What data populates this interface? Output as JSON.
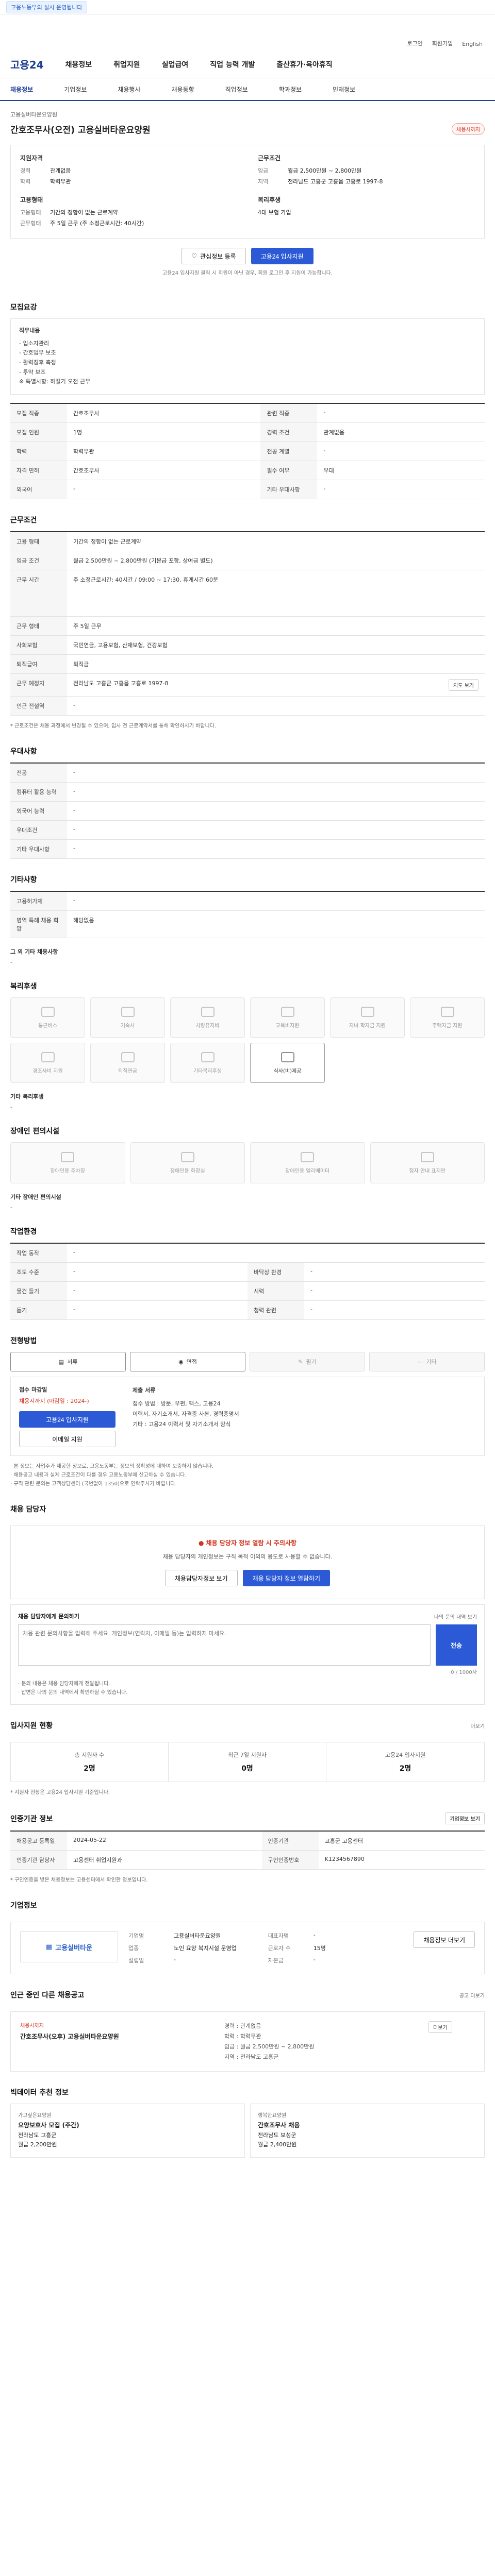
{
  "topbar": {
    "banner": "고용노동부의 실시 운영됩니다"
  },
  "util": {
    "login": "로그인",
    "join": "회원가입",
    "lang": "English"
  },
  "gnb": {
    "logo": "고용24",
    "menus": [
      "채용정보",
      "취업지원",
      "실업급여",
      "직업 능력 개발",
      "출산휴가·육아휴직"
    ]
  },
  "lnb": {
    "items": [
      "채용정보",
      "기업정보",
      "채용행사",
      "채용동향",
      "직업정보",
      "학과정보",
      "인재정보"
    ]
  },
  "job": {
    "company": "고용실버타운요양원",
    "title": "간호조무사(오전) 고용실버타운요양원",
    "badge": "채용시까지"
  },
  "summary": {
    "qual_title": "지원자격",
    "qual": [
      {
        "k": "경력",
        "v": "관계없음"
      },
      {
        "k": "학력",
        "v": "학력무관"
      }
    ],
    "cond_title": "근무조건",
    "cond": [
      {
        "k": "임금",
        "v": "월급 2,500만원 ~ 2,800만원"
      },
      {
        "k": "지역",
        "v": "전라남도 고흥군 고흥읍 고흥로 1997-8"
      }
    ],
    "place_title": "고용형태",
    "place": [
      {
        "k": "고용형태",
        "v": "기간의 정함이 없는 근로계약"
      },
      {
        "k": "근무형태",
        "v": "주 5일 근무 (주 소정근로시간: 40시간)"
      }
    ],
    "welfare_title": "복리후생",
    "welfare": "4대 보험 가입"
  },
  "actions": {
    "scrap": "관심정보 등록",
    "apply": "고용24 입사지원"
  },
  "note_center": "고용24 입사지원 클릭 시 회원이 아닌 경우, 회원 로그인 후 지원이 가능합니다.",
  "s_recruit": {
    "title": "모집요강",
    "intro_title": "직무내용",
    "intro_lines": [
      "- 입소자관리",
      "- 간호업무 보조",
      "- 활력징후 측정",
      "- 투약 보조",
      "※ 특별사항: 하절기 오전 근무"
    ],
    "rows": [
      {
        "k1": "모집 직종",
        "v1": "간호조무사",
        "k2": "관련 직종",
        "v2": "-"
      },
      {
        "k1": "모집 인원",
        "v1": "1명",
        "k2": "경력 조건",
        "v2": "관계없음"
      },
      {
        "k1": "학력",
        "v1": "학력무관",
        "k2": "전공 계열",
        "v2": "-"
      },
      {
        "k1": "자격 면허",
        "v1": "간호조무사",
        "k2": "필수 여부",
        "v2": "우대"
      },
      {
        "k1": "외국어",
        "v1": "-",
        "k2": "기타 우대사항",
        "v2": "-"
      }
    ]
  },
  "s_cond": {
    "title": "근무조건",
    "rows": [
      {
        "k": "고용 형태",
        "v": "기간의 정함이 없는 근로계약"
      },
      {
        "k": "임금 조건",
        "v": "월급 2,500만원 ~ 2,800만원 (기본급 포함, 상여금 별도)"
      },
      {
        "k": "근무 시간",
        "v": "주 소정근로시간: 40시간  /  09:00 ~ 17:30, 휴게시간 60분"
      },
      {
        "k": "근무 형태",
        "v": "주 5일 근무"
      },
      {
        "k": "사회보험",
        "v": "국민연금, 고용보험, 산재보험, 건강보험"
      },
      {
        "k": "퇴직급여",
        "v": "퇴직금"
      },
      {
        "k": "근무 예정지",
        "v": "전라남도 고흥군 고흥읍 고흥로 1997-8"
      },
      {
        "k": "인근 전철역",
        "v": "-"
      }
    ],
    "map_btn": "지도 보기",
    "foot": "* 근로조건은 채용 과정에서 변경될 수 있으며, 입사 전 근로계약서를 통해 확인하시기 바랍니다."
  },
  "s_prefer": {
    "title": "우대사항",
    "rows": [
      {
        "k": "전공",
        "v": "-"
      },
      {
        "k": "컴퓨터 활용 능력",
        "v": "-"
      },
      {
        "k": "외국어 능력",
        "v": "-"
      },
      {
        "k": "우대조건",
        "v": "-"
      },
      {
        "k": "기타 우대사항",
        "v": "-"
      }
    ]
  },
  "s_etc": {
    "title": "기타사항",
    "rows": [
      {
        "k": "고용허가제",
        "v": "-"
      },
      {
        "k": "병역 특례 채용 희망",
        "v": "해당없음"
      }
    ],
    "extra_title": "그 외 기타 채용사항",
    "extra_val": "-"
  },
  "s_welfare": {
    "title": "복리후생",
    "cards": [
      "통근버스",
      "기숙사",
      "차량유지비",
      "교육비지원",
      "자녀 학자금 지원",
      "주택자금 지원",
      "경조사비 지원",
      "퇴직연금",
      "기타복리후생",
      "식사(비)제공"
    ],
    "other_title": "기타 복리후생",
    "other_val": "-"
  },
  "s_disabled": {
    "title": "장애인 편의시설",
    "cards": [
      "장애인용 주차장",
      "장애인용 화장실",
      "장애인용 엘리베이터",
      "점자 안내 표지판"
    ],
    "other_title": "기타 장애인 편의시설",
    "other_val": "-"
  },
  "s_env": {
    "title": "작업환경",
    "rows": [
      {
        "k1": "작업 동작",
        "v1": "-",
        "k2": "",
        "v2": ""
      },
      {
        "k1": "조도 수준",
        "v1": "-",
        "k2": "바닥상 환경",
        "v2": "-"
      },
      {
        "k1": "물건 들기",
        "v1": "-",
        "k2": "시력",
        "v2": "-"
      },
      {
        "k1": "듣기",
        "v1": "-",
        "k2": "청력 관련",
        "v2": "-"
      }
    ]
  },
  "s_method": {
    "title": "전형방법",
    "methods": [
      "서류",
      "면접",
      "필기",
      "기타"
    ],
    "apply_title": "접수 마감일",
    "apply_deadline": "채용시까지 (마감일 : 2024-)",
    "apply_btn1": "고용24 입사지원",
    "apply_btn2": "이메일 지원",
    "docs_title": "제출 서류",
    "docs": "이력서, 자기소개서, 자격증 사본, 경력증명서",
    "contact": "기타 : 고용24 이력서 및 자기소개서 양식",
    "method_note": "접수 방법 : 방문, 우편, 팩스, 고용24"
  },
  "notes": [
    "· 본 정보는 사업주가 제공한 정보로, 고용노동부는 정보의 정확성에 대하여 보증하지 않습니다.",
    "· 채용공고 내용과 실제 근로조건이 다를 경우 고용노동부에 신고하실 수 있습니다.",
    "· 구직 관련 문의는 고객상담센터 (국번없이 1350)으로 연락주시기 바랍니다."
  ],
  "s_manager": {
    "title": "채용 담당자",
    "warn": "채용 담당자 정보 열람 시 주의사항",
    "desc": "채용 담당자의 개인정보는 구직 목적 이외의 용도로 사용할 수 없습니다.",
    "btn1": "채용담당자정보 보기",
    "btn2": "채용 담당자 정보 열람하기"
  },
  "s_qna": {
    "title": "채용 담당자에게 문의하기",
    "link": "나의 문의 내역 보기",
    "placeholder": "채용 관련 문의사항을 입력해 주세요. 개인정보(연락처, 이메일 등)는 입력하지 마세요.",
    "send": "전송",
    "counter": "0 / 1000자",
    "bullets": [
      "· 문의 내용은 채용 담당자에게 전달됩니다.",
      "· 답변은 나의 문의 내역에서 확인하실 수 있습니다."
    ]
  },
  "s_status": {
    "title": "입사지원 현황",
    "link": "더보기",
    "cells": [
      {
        "k": "총 지원자 수",
        "v": "2명"
      },
      {
        "k": "최근 7일 지원자",
        "v": "0명"
      },
      {
        "k": "고용24 입사지원",
        "v": "2명"
      }
    ],
    "note": "* 지원자 현황은 고용24 입사지원 기준입니다."
  },
  "s_info": {
    "title": "인증기관 정보",
    "btn": "기업정보 보기",
    "rows": [
      {
        "k1": "채용공고 등록일",
        "v1": "2024-05-22",
        "k2": "인증기관",
        "v2": "고흥군 고용센터"
      },
      {
        "k1": "인증기관 담당자",
        "v1": "고용센터 취업지원과",
        "k2": "구인인증번호",
        "v2": "K1234567890"
      }
    ],
    "note": "* 구인인증을 받은 채용정보는 고용센터에서 확인한 정보입니다."
  },
  "s_corp": {
    "title": "기업정보",
    "logo": "고용실버타운",
    "rows": [
      {
        "k": "기업명",
        "v": "고용실버타운요양원"
      },
      {
        "k": "대표자명",
        "v": "-"
      },
      {
        "k": "업종",
        "v": "노인 요양 복지시설 운영업"
      },
      {
        "k": "근로자 수",
        "v": "15명"
      },
      {
        "k": "설립일",
        "v": "-"
      },
      {
        "k": "자본금",
        "v": "-"
      }
    ],
    "btn": "채용정보 더보기"
  },
  "s_similar": {
    "title": "인근 중인 다른 채용공고",
    "link": "공고 더보기",
    "left_tag": "채용시까지",
    "left_title": "간호조무사(오후) 고용실버타운요양원",
    "right": [
      "경력 : 관계없음",
      "학력 : 학력무관",
      "임금 : 월급 2,500만원 ~ 2,800만원",
      "지역 : 전라남도 고흥군"
    ],
    "badge": "더보기"
  },
  "s_reco": {
    "title": "빅데이터 추천 정보",
    "cards": [
      {
        "co": "가고싶은요양원",
        "ti": "요양보호사 모집 (주간)",
        "a": "전라남도 고흥군",
        "b": "월급 2,200만원"
      },
      {
        "co": "행복한요양원",
        "ti": "간호조무사 채용",
        "a": "전라남도 보성군",
        "b": "월급 2,400만원"
      }
    ]
  }
}
